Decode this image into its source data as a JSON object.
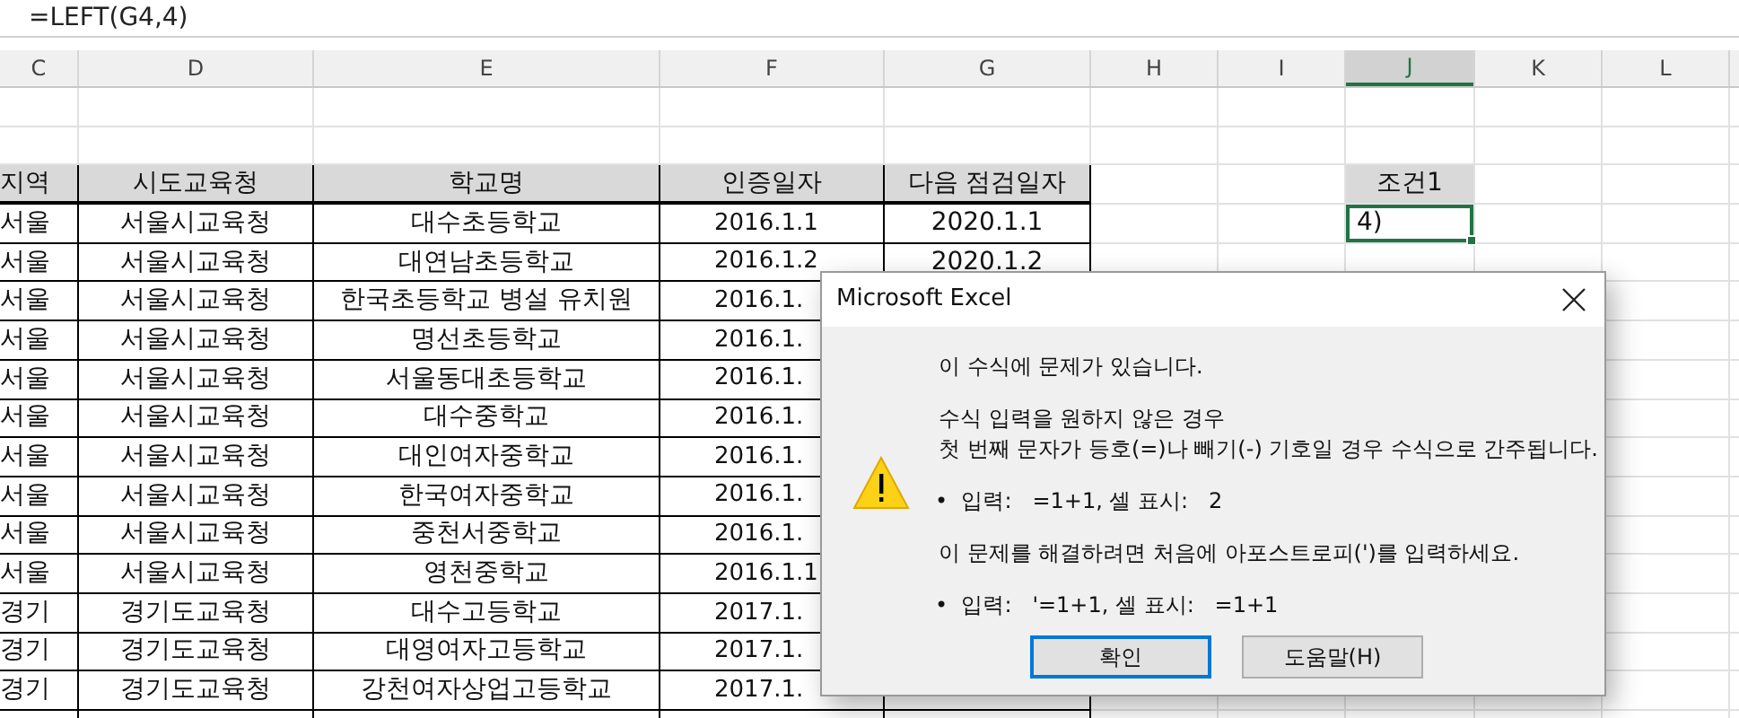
{
  "formula_bar": {
    "formula": "=LEFT(G4,4)"
  },
  "column_headers": [
    {
      "label": "C",
      "selected": false
    },
    {
      "label": "D",
      "selected": false
    },
    {
      "label": "E",
      "selected": false
    },
    {
      "label": "F",
      "selected": false
    },
    {
      "label": "G",
      "selected": false
    },
    {
      "label": "H",
      "selected": false
    },
    {
      "label": "I",
      "selected": false
    },
    {
      "label": "J",
      "selected": true
    },
    {
      "label": "K",
      "selected": false
    },
    {
      "label": "L",
      "selected": false
    }
  ],
  "table": {
    "columns": [
      "지역",
      "시도교육청",
      "학교명",
      "인증일자",
      "다음 점검일자"
    ],
    "rows": [
      [
        "서울",
        "서울시교육청",
        "대수초등학교",
        "2016.1.1",
        "2020.1.1"
      ],
      [
        "서울",
        "서울시교육청",
        "대연남초등학교",
        "2016.1.2",
        "2020.1.2"
      ],
      [
        "서울",
        "서울시교육청",
        "한국초등학교 병설 유치원",
        "2016.1."
      ],
      [
        "서울",
        "서울시교육청",
        "명선초등학교",
        "2016.1."
      ],
      [
        "서울",
        "서울시교육청",
        "서울동대초등학교",
        "2016.1."
      ],
      [
        "서울",
        "서울시교육청",
        "대수중학교",
        "2016.1."
      ],
      [
        "서울",
        "서울시교육청",
        "대인여자중학교",
        "2016.1."
      ],
      [
        "서울",
        "서울시교육청",
        "한국여자중학교",
        "2016.1."
      ],
      [
        "서울",
        "서울시교육청",
        "중천서중학교",
        "2016.1."
      ],
      [
        "서울",
        "서울시교육청",
        "영천중학교",
        "2016.1.1"
      ],
      [
        "경기",
        "경기도교육청",
        "대수고등학교",
        "2017.1."
      ],
      [
        "경기",
        "경기도교육청",
        "대영여자고등학교",
        "2017.1."
      ],
      [
        "경기",
        "경기도교육청",
        "강천여자상업고등학교",
        "2017.1."
      ]
    ]
  },
  "condition": {
    "header": "조건1",
    "value": "4)",
    "selected": true
  },
  "dialog": {
    "title": "Microsoft Excel",
    "lines": [
      {
        "kind": "text",
        "text": "이 수식에 문제가 있습니다."
      },
      {
        "kind": "gap"
      },
      {
        "kind": "text",
        "text": "수식 입력을 원하지 않은 경우"
      },
      {
        "kind": "text",
        "text": "첫 번째 문자가 등호(=)나 빼기(-) 기호일 경우 수식으로 간주됩니다."
      },
      {
        "kind": "gap"
      },
      {
        "kind": "bullet",
        "text": "•  입력:   =1+1, 셀 표시:   2"
      },
      {
        "kind": "gap"
      },
      {
        "kind": "text",
        "text": "이 문제를 해결하려면 처음에 아포스트로피(')를 입력하세요."
      },
      {
        "kind": "gap"
      },
      {
        "kind": "bullet",
        "text": "•  입력:   '=1+1, 셀 표시:   =1+1"
      }
    ],
    "buttons": [
      {
        "label": "확인",
        "selected": true
      },
      {
        "label": "도움말(H)",
        "selected": false
      }
    ]
  }
}
